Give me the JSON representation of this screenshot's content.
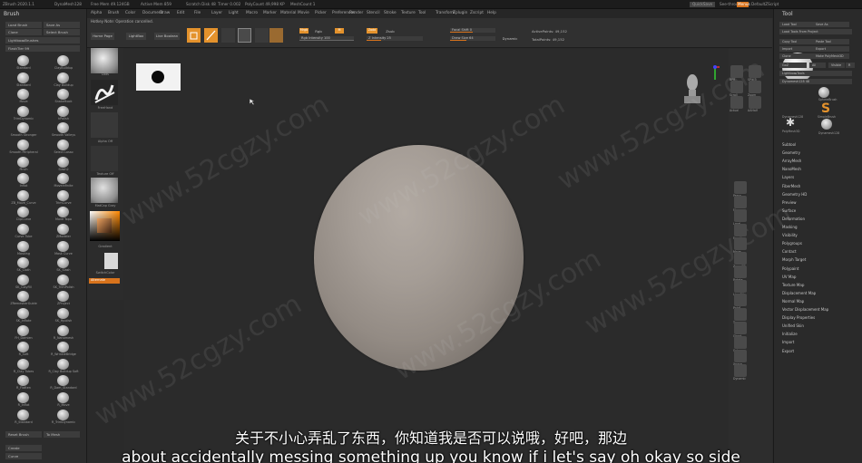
{
  "titlebar": {
    "app": "ZBrush 2020.1.1",
    "items": [
      "DynaMesh128",
      "Free Mem 49.124GB",
      "Active Mem 859",
      "Scratch Disk 48",
      "Timer 0.002",
      "PolyCount 49,998 KP",
      "MeshCount 1"
    ],
    "quicksave": "QuickSave",
    "see_through": "See-through 0",
    "menus_label": "Menus",
    "script": "DefaultZScript"
  },
  "menubar": {
    "items": [
      "Alpha",
      "Brush",
      "Color",
      "Document",
      "Draw",
      "Edit",
      "File",
      "Layer",
      "Light",
      "Macro",
      "Marker",
      "Material",
      "Movie",
      "Picker",
      "Preferences",
      "Render",
      "Stencil",
      "Stroke",
      "Texture",
      "Tool",
      "Transform",
      "Zplugin",
      "Zscript",
      "Help"
    ]
  },
  "info_text": "Hotkey Note: Operation cancelled.",
  "left_panel": {
    "title": "Brush",
    "buttons": [
      "Load Brush",
      "Save As",
      "Clone",
      "Select Brush",
      "Lightbox▸Brushes",
      "FlashTier 99"
    ],
    "brushes": [
      "Standard",
      "ClayBuildup",
      "Standard",
      "Clay Buildup",
      "Move",
      "SnakeHook",
      "TrimDynamic",
      "hPolish",
      "Smooth Stronger",
      "Smooth Valleys",
      "Smooth Peripheral",
      "Select Lasso",
      "Pinch",
      "Slash2",
      "Inflat",
      "MoveInfinite",
      "ZB_Move_Curve",
      "TrimCurve",
      "ClipCurve",
      "Move Topo",
      "Curve Tube",
      "ZModeler",
      "Masking",
      "Mask Curve",
      "SK_Cloth",
      "SK_Slash",
      "SK_ClayFill",
      "SK_TrimPolish",
      "ZRemesherGuide",
      "ZProject",
      "SK_Inflate",
      "SK_Hpolish",
      "FH_Damien",
      "R_Nanomesh",
      "R_Soft",
      "R_WrinkleBridge",
      "R_Clay Tubes",
      "R_Clay Buildup Soft",
      "R_Flatten",
      "R_Dam_Standard",
      "R_Inflat",
      "R_Move",
      "R_Standard",
      "R_TrimDynamic"
    ],
    "bottom_buttons": [
      "Reset Brush",
      "To Mesh",
      "Create",
      "Curve"
    ]
  },
  "shelf": {
    "labels": [
      "Dots",
      "FreeHand",
      "Alpha Off",
      "Texture Off",
      "MatCap Gray",
      "Gradient",
      "SwitchColor",
      "Alternate"
    ]
  },
  "toolbar": {
    "buttons": [
      "Home Page",
      "LightBox",
      "Live Boolean"
    ],
    "edit": "Edit",
    "draw": "Draw",
    "move": "Move",
    "scale": "Scale",
    "rotate": "Rotate",
    "mrgb": "Mrgb",
    "rgb": "Rgb",
    "m": "M",
    "zadd": "Zadd",
    "zsub": "Zsub",
    "zcut": "Zcut",
    "rgb_intensity": "Rgb Intensity 100",
    "z_intensity": "Z Intensity 25",
    "focal_shift": "Focal Shift 0",
    "draw_size": "Draw Size 64",
    "dynamic": "Dynamic",
    "active_points": "ActivePoints: 49,152",
    "total_points": "TotalPoints: 49,152"
  },
  "right_dock": {
    "labels": [
      "BPR",
      "SPix 3",
      "Scroll",
      "Zoom",
      "Actual",
      "AAHalf",
      "Persp",
      "Floor",
      "Local",
      "Frame",
      "Move",
      "Zoom3D",
      "Rotate",
      "Line Fill",
      "PolyF",
      "Transp",
      "Ghost",
      "Solo",
      "Xpose",
      "Dynamic"
    ],
    "accent": "#d8731c"
  },
  "tool_panel": {
    "title": "Tool",
    "buttons": [
      "Load Tool",
      "Save As",
      "Load Tools From Project",
      "Copy Tool",
      "Paste Tool",
      "Import",
      "Export",
      "Clone",
      "Make PolyMesh3D",
      "GoZ",
      "All",
      "Visible",
      "R",
      "Lightbox▸Tools",
      "Dynamesh128  48"
    ],
    "tools": [
      "Dynamesh128",
      "SphereBrush",
      "SimpleBrush",
      "PolyMesh3D",
      "Dynamesh128"
    ],
    "sections": [
      "Subtool",
      "Geometry",
      "ArrayMesh",
      "NanoMesh",
      "Layers",
      "FiberMesh",
      "Geometry HD",
      "Preview",
      "Surface",
      "Deformation",
      "Masking",
      "Visibility",
      "Polygroups",
      "Contact",
      "Morph Target",
      "Polypaint",
      "UV Map",
      "Texture Map",
      "Displacement Map",
      "Normal Map",
      "Vector Displacement Map",
      "Display Properties",
      "Unified Skin",
      "Initialize",
      "Import",
      "Export"
    ]
  },
  "subtitles": {
    "zh": "关于不小心弄乱了东西，你知道我是否可以说哦，好吧，那边",
    "en": "about accidentally messing something up you know if i let's say oh okay so side"
  },
  "watermark": "www.52cgzy.com",
  "colors": {
    "accent_orange": "#e4922c",
    "sphere": "#a8a099",
    "background": "#2b2b2b"
  }
}
